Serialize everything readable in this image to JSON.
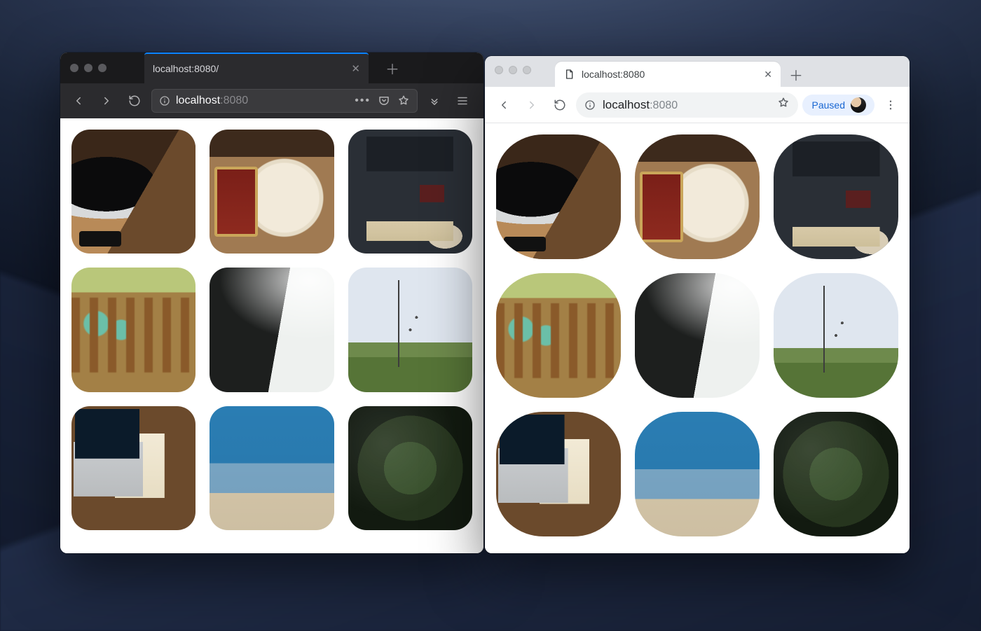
{
  "firefox": {
    "tab_title": "localhost:8080/",
    "url_host": "localhost",
    "url_port": ":8080"
  },
  "chrome": {
    "tab_title": "localhost:8080",
    "url_host": "localhost",
    "url_port": ":8080",
    "paused_label": "Paused"
  },
  "thumbs": [
    "laptop-on-desk",
    "coffee-mug",
    "desk-flatlay",
    "mason-jars-fence",
    "mountain-mist",
    "bare-tree",
    "workspace-notebook",
    "beach",
    "moss-rock"
  ]
}
